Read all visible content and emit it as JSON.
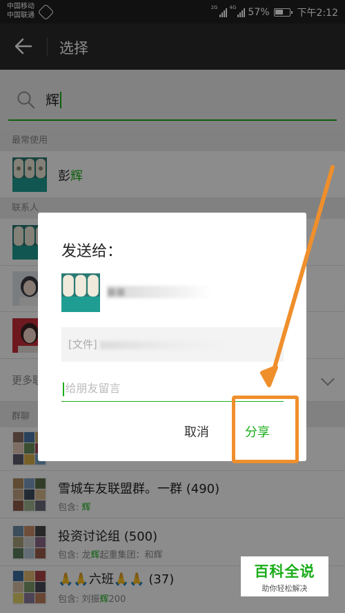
{
  "status_bar": {
    "carrier_1": "中国移动",
    "carrier_2": "中国联通",
    "network_1": "2G",
    "network_2": "4G",
    "battery": "57%",
    "time": "下午2:12"
  },
  "title_bar": {
    "title": "选择",
    "back_icon": "arrow-left-icon"
  },
  "search": {
    "query": "辉",
    "icon": "search-icon"
  },
  "sections": {
    "frequent": "最常使用",
    "contacts": "联系人",
    "more": "更多联系人",
    "groups": "群聊"
  },
  "frequent_items": [
    {
      "name_pre": "彭",
      "name_hl": "辉"
    }
  ],
  "group_items": [
    {
      "name": "雪城车友联盟群。一群 (490)",
      "sub_pre": "包含: ",
      "sub_hl": "辉",
      "sub_post": ""
    },
    {
      "name": "投资讨论组 (500)",
      "sub_pre": "包含: 龙",
      "sub_hl": "辉",
      "sub_post": "起重集团：和辉"
    },
    {
      "name": "🙏🙏六班🙏🙏 (37)",
      "sub_pre": "包含: 刘振",
      "sub_hl": "辉",
      "sub_post": "200"
    }
  ],
  "dialog": {
    "title": "发送给：",
    "recipient": "■■",
    "file_prefix": "[文件]",
    "message_placeholder": "给朋友留言",
    "cancel": "取消",
    "share": "分享"
  },
  "colors": {
    "accent": "#1aad19",
    "annotation": "#ef8f2c",
    "title_bar": "#2b2b2b"
  },
  "watermark": {
    "title": "百科全说",
    "subtitle": "助你轻松解决"
  }
}
